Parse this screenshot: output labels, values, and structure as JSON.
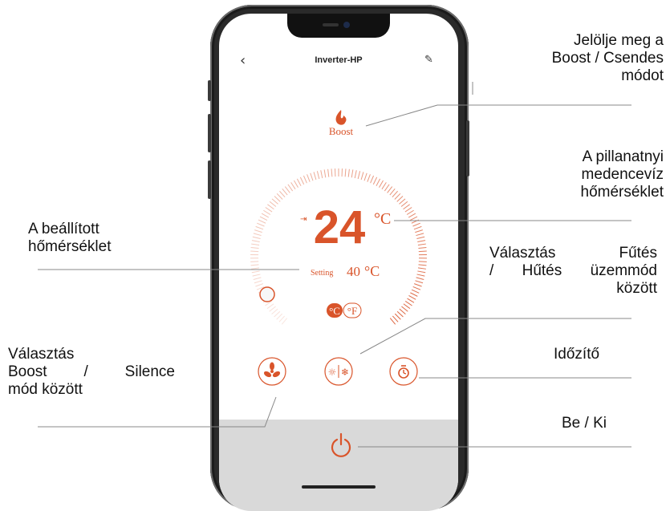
{
  "app": {
    "title": "Inverter-HP",
    "back_icon": "chevron-left-icon",
    "edit_icon": "pencil-icon"
  },
  "mode": {
    "icon": "flame-icon",
    "label": "Boost"
  },
  "temperature": {
    "current": "24",
    "current_unit": "°C",
    "setting_label": "Setting",
    "setting_value": "40",
    "setting_unit": "°C",
    "unit_celsius": "°C",
    "unit_fahrenheit": "°F"
  },
  "controls": {
    "fan_icon": "fan-icon",
    "mode_icon": "sun-snowflake-icon",
    "timer_icon": "timer-icon",
    "power_icon": "power-icon"
  },
  "annotations": {
    "boost_silent": [
      "Jelölje meg a",
      "Boost / Csendes",
      "módot"
    ],
    "current_temp": [
      "A pillanatnyi",
      "medencevíz",
      "hőmérséklet"
    ],
    "set_temp": [
      "A beállított",
      "hőmérséklet"
    ],
    "heat_cool": [
      "Választás   Fűtés",
      "/ Hűtés üzemmód",
      "között"
    ],
    "boost_silence": [
      "Választás",
      "Boost   /   Silence",
      "mód között"
    ],
    "timer": "Időzítő",
    "power": "Be / Ki"
  },
  "colors": {
    "accent": "#d9542a",
    "bottom_bar": "#d9d9d9"
  }
}
